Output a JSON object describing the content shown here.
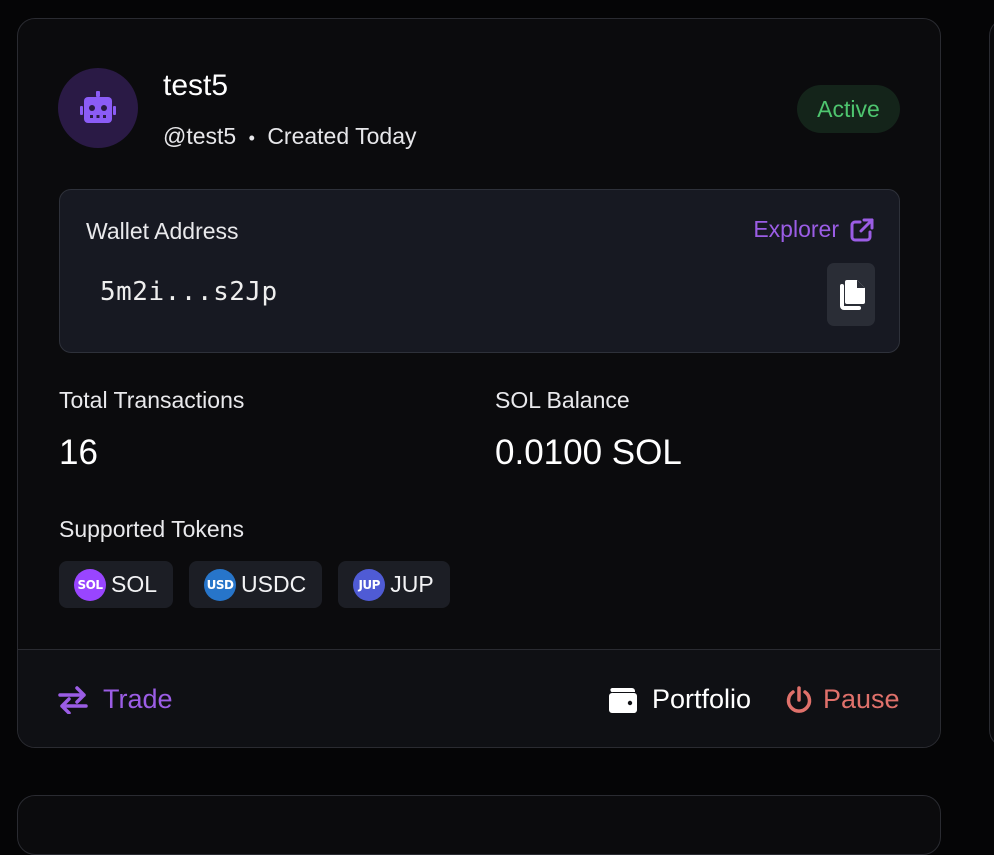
{
  "agent": {
    "name": "test5",
    "handle": "@test5",
    "separator": "•",
    "created": "Created Today",
    "status": "Active",
    "avatar_icon": "robot-icon"
  },
  "wallet": {
    "label": "Wallet Address",
    "explorer_label": "Explorer",
    "address": "5m2i...s2Jp"
  },
  "stats": {
    "transactions_label": "Total Transactions",
    "transactions_value": "16",
    "balance_label": "SOL Balance",
    "balance_value": "0.0100 SOL"
  },
  "tokens": {
    "label": "Supported Tokens",
    "items": [
      {
        "icon_text": "SOL",
        "name": "SOL",
        "color": "#9945ff"
      },
      {
        "icon_text": "USD",
        "name": "USDC",
        "color": "#2775ca"
      },
      {
        "icon_text": "JUP",
        "name": "JUP",
        "color": "#4f5bd5"
      }
    ]
  },
  "actions": {
    "trade": "Trade",
    "portfolio": "Portfolio",
    "pause": "Pause"
  },
  "colors": {
    "accent": "#9b5de5",
    "active_text": "#4ec56f",
    "pause": "#e0716b"
  }
}
